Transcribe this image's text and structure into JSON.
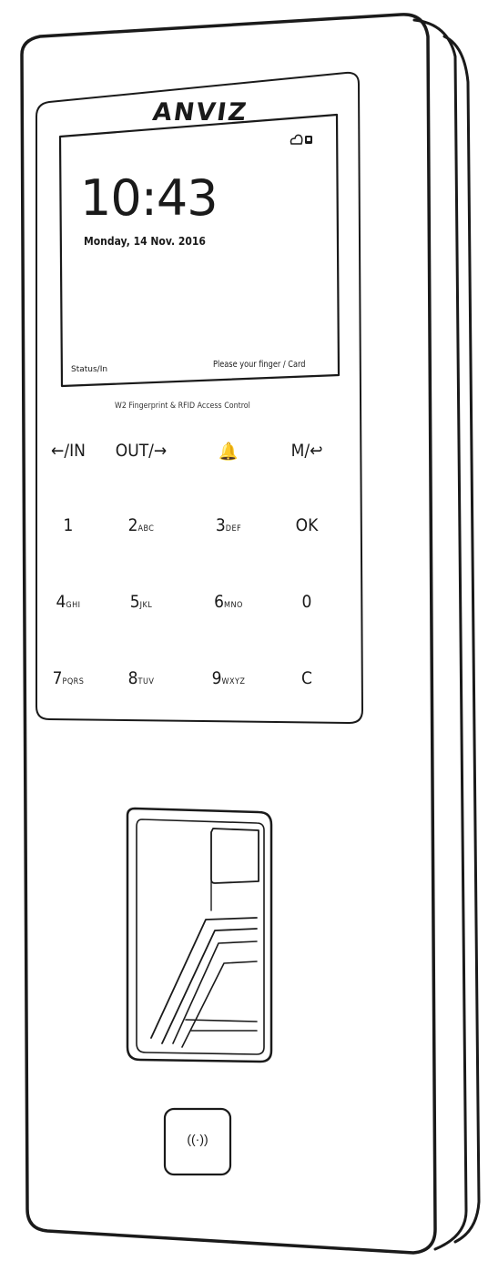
{
  "device": {
    "brand": "ANVIZ",
    "model_label": "W2 Fingerprint & RFID Access Control"
  },
  "screen": {
    "time": "10:43",
    "date": "Monday, 14 Nov. 2016",
    "status": "Status/In",
    "prompt": "Please your finger / Card",
    "icons": [
      "cloud-icon",
      "lock-icon"
    ]
  },
  "keypad": {
    "rows": [
      [
        {
          "main": "←/IN",
          "sub": ""
        },
        {
          "main": "OUT/→",
          "sub": ""
        },
        {
          "main": "🔔",
          "sub": ""
        },
        {
          "main": "M/↩",
          "sub": ""
        }
      ],
      [
        {
          "main": "1",
          "sub": ""
        },
        {
          "main": "2",
          "sub": "ABC"
        },
        {
          "main": "3",
          "sub": "DEF"
        },
        {
          "main": "OK",
          "sub": ""
        }
      ],
      [
        {
          "main": "4",
          "sub": "GHI"
        },
        {
          "main": "5",
          "sub": "JKL"
        },
        {
          "main": "6",
          "sub": "MNO"
        },
        {
          "main": "0",
          "sub": ""
        }
      ],
      [
        {
          "main": "7",
          "sub": "PQRS"
        },
        {
          "main": "8",
          "sub": "TUV"
        },
        {
          "main": "9",
          "sub": "WXYZ"
        },
        {
          "main": "C",
          "sub": ""
        }
      ]
    ]
  },
  "rfid_symbol": "((·))"
}
